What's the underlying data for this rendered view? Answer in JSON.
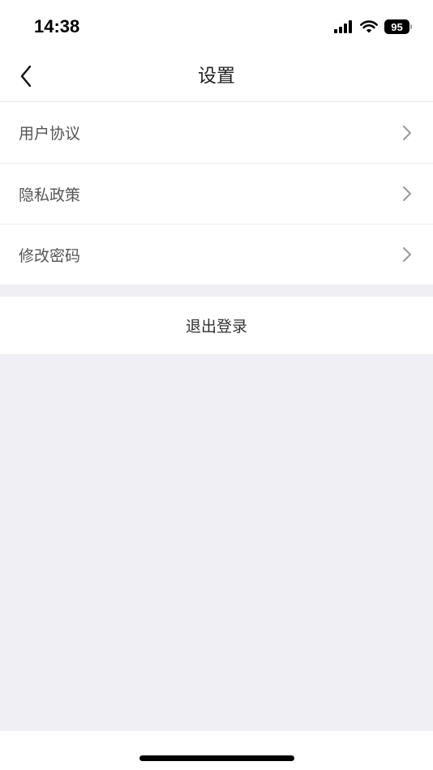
{
  "status_bar": {
    "time": "14:38",
    "battery_level": "95",
    "signal_icon": "cellular-signal-icon",
    "wifi_icon": "wifi-icon"
  },
  "nav": {
    "title": "设置",
    "back_icon": "chevron-left-icon"
  },
  "menu": {
    "items": [
      {
        "label": "用户协议",
        "icon": "chevron-right-icon"
      },
      {
        "label": "隐私政策",
        "icon": "chevron-right-icon"
      },
      {
        "label": "修改密码",
        "icon": "chevron-right-icon"
      }
    ]
  },
  "logout": {
    "label": "退出登录"
  },
  "colors": {
    "background": "#efeff4",
    "surface": "#ffffff",
    "text_primary": "#222222",
    "text_secondary": "#555555",
    "chevron": "#999999"
  }
}
